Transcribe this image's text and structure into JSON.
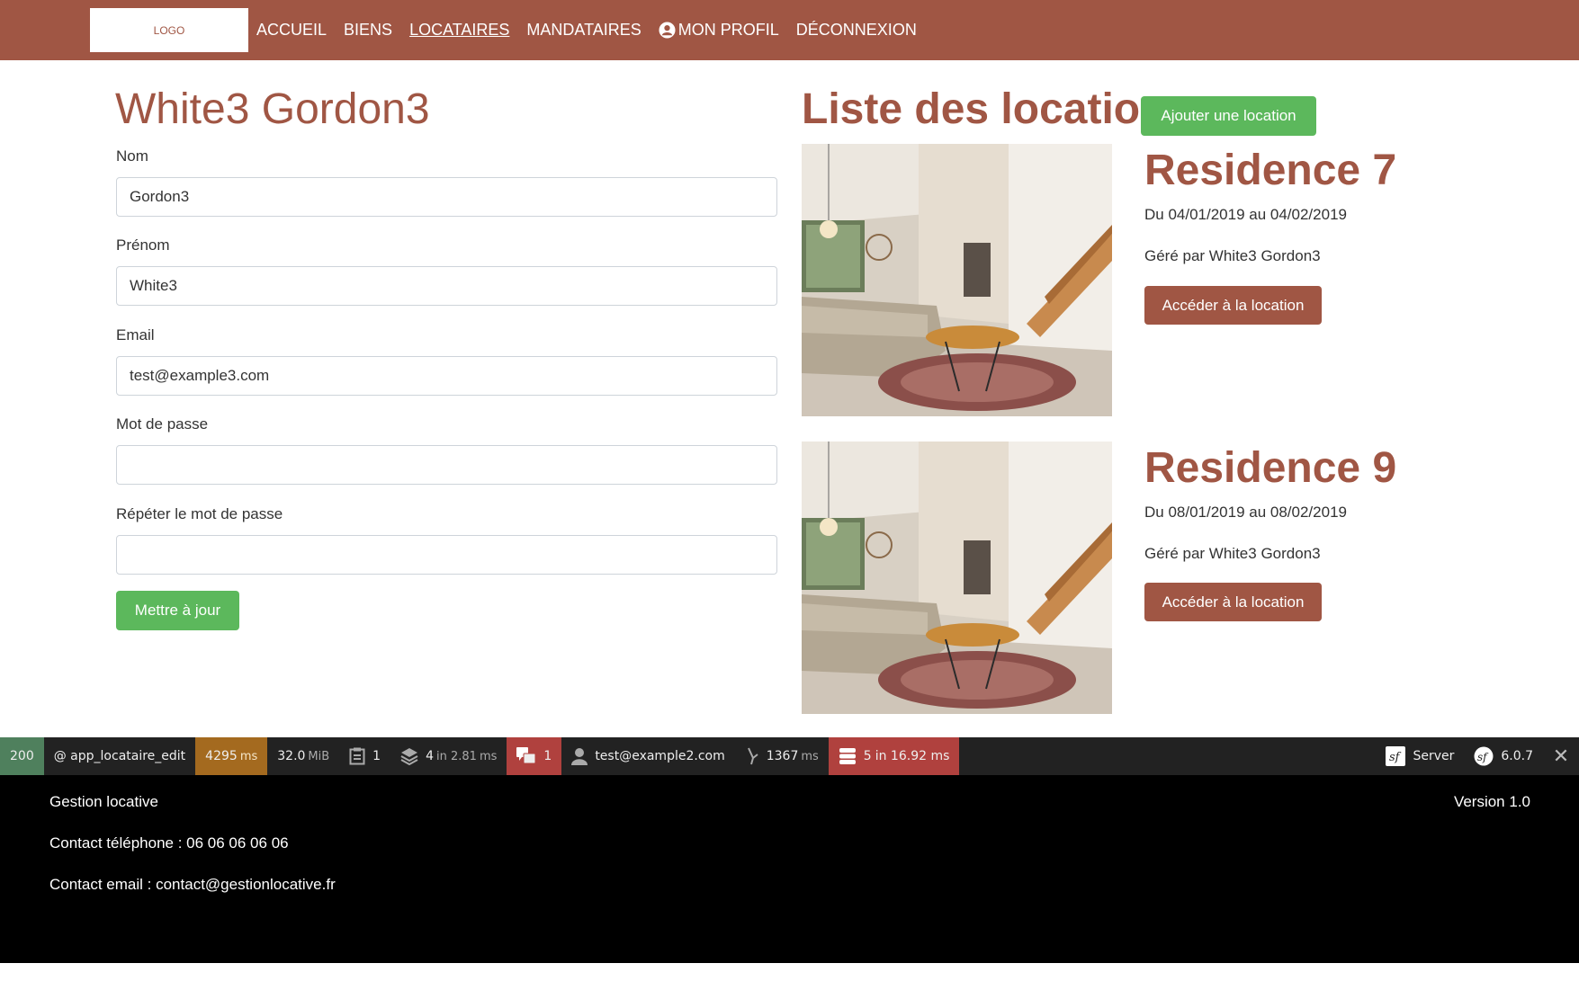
{
  "nav": {
    "logo": "LOGO",
    "links": [
      "ACCUEIL",
      "BIENS",
      "LOCATAIRES",
      "MANDATAIRES",
      "MON PROFIL",
      "DÉCONNEXION"
    ],
    "active": "LOCATAIRES"
  },
  "tenant": {
    "name": "White3 Gordon3",
    "fields": {
      "nom_label": "Nom",
      "nom_value": "Gordon3",
      "prenom_label": "Prénom",
      "prenom_value": "White3",
      "email_label": "Email",
      "email_value": "test@example3.com",
      "password_label": "Mot de passe",
      "password_value": "",
      "repeat_label": "Répéter le mot de passe",
      "repeat_value": ""
    },
    "submit_label": "Mettre à jour"
  },
  "locations": {
    "title": "Liste des locations",
    "add_label": "Ajouter une location",
    "items": [
      {
        "name": "Residence 7",
        "dates": "Du 04/01/2019 au 04/02/2019",
        "manager": "Géré par White3 Gordon3",
        "button": "Accéder à la location"
      },
      {
        "name": "Residence 9",
        "dates": "Du 08/01/2019 au 08/02/2019",
        "manager": "Géré par White3 Gordon3",
        "button": "Accéder à la location"
      }
    ]
  },
  "toolbar": {
    "status": "200",
    "route": "@ app_locataire_edit",
    "time_value": "4295",
    "time_unit": "ms",
    "memory_value": "32.0",
    "memory_unit": "MiB",
    "forms_count": "1",
    "templates_value": "4",
    "templates_unit": "in 2.81",
    "templates_ms": "ms",
    "translations_count": "1",
    "user": "test@example2.com",
    "lazy_value": "1367",
    "lazy_unit": "ms",
    "db_value": "5",
    "db_unit": "in 16.92 ms",
    "server": "Server",
    "version": "6.0.7",
    "colors": {
      "ok": "#4f805d",
      "warn": "#a46a1f",
      "error": "#b0413e"
    }
  },
  "footer": {
    "title": "Gestion locative",
    "phone": "Contact téléphone : 06 06 06 06 06",
    "email": "Contact email : contact@gestionlocative.fr",
    "version": "Version 1.0"
  }
}
